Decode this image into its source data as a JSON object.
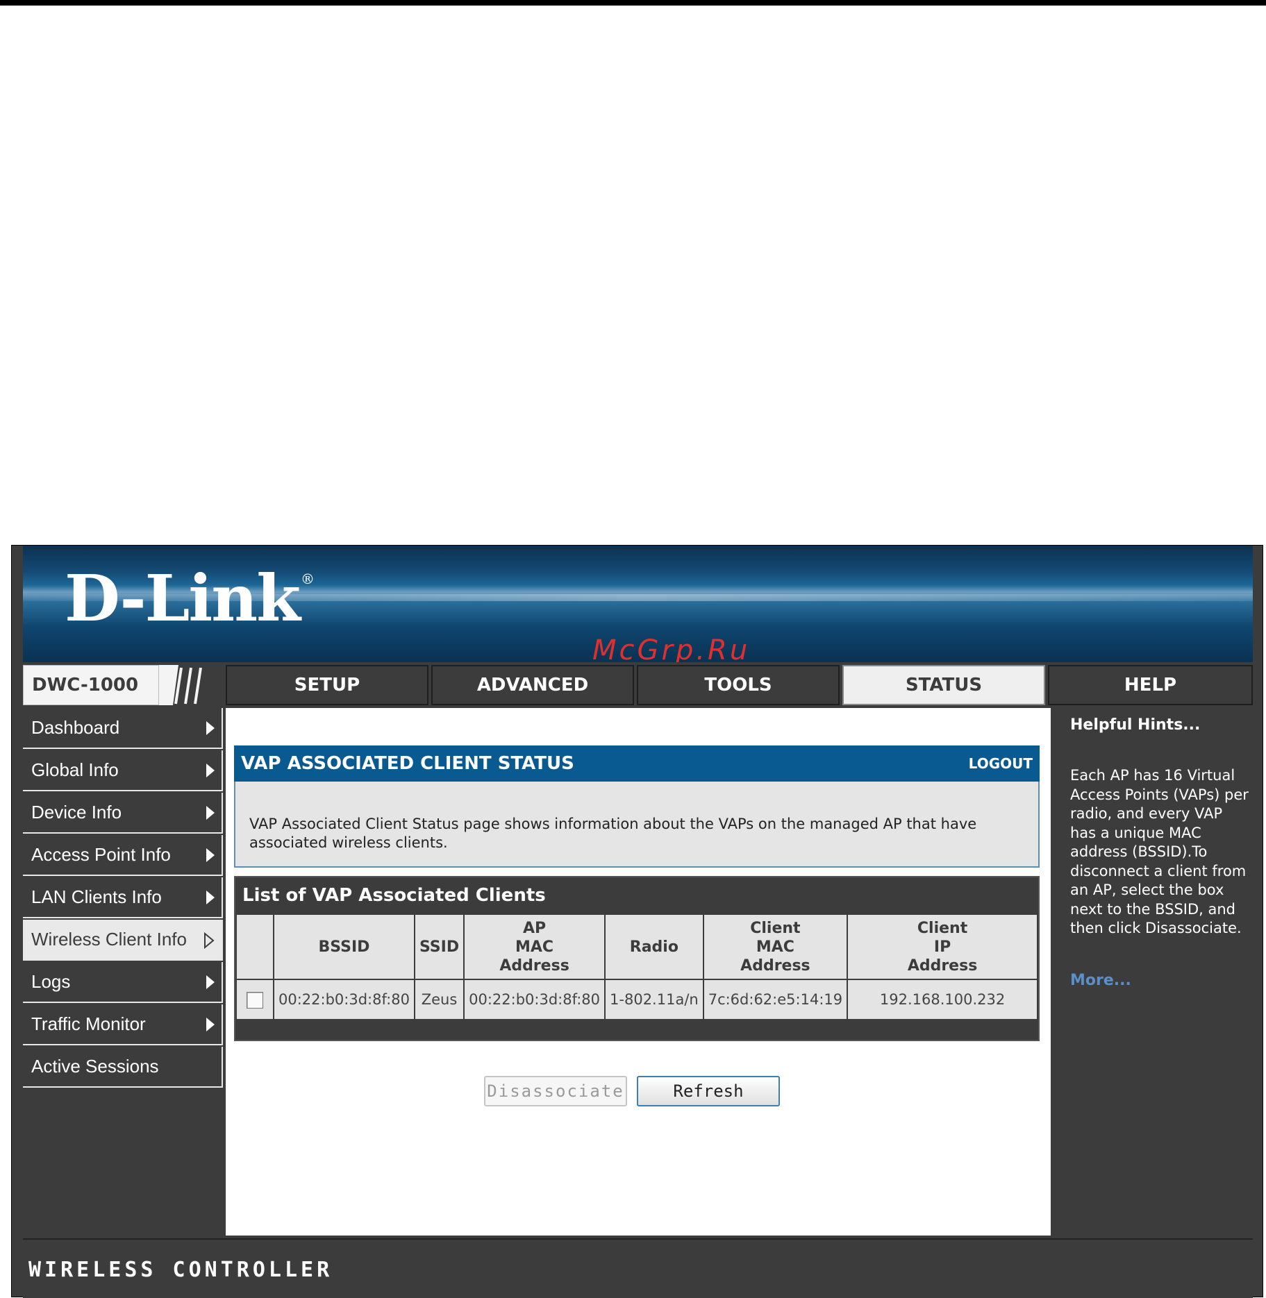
{
  "header": {
    "logo": "D-Link",
    "logo_mark": "®",
    "watermark": "McGrp.Ru",
    "model": "DWC-1000"
  },
  "nav": {
    "tabs": [
      {
        "label": "SETUP"
      },
      {
        "label": "ADVANCED"
      },
      {
        "label": "TOOLS"
      },
      {
        "label": "STATUS",
        "active": true
      },
      {
        "label": "HELP"
      }
    ]
  },
  "sidebar": {
    "items": [
      {
        "label": "Dashboard"
      },
      {
        "label": "Global Info"
      },
      {
        "label": "Device Info"
      },
      {
        "label": "Access Point Info"
      },
      {
        "label": "LAN Clients Info"
      },
      {
        "label": "Wireless Client Info",
        "active": true
      },
      {
        "label": "Logs"
      },
      {
        "label": "Traffic Monitor"
      },
      {
        "label": "Active Sessions"
      }
    ]
  },
  "main": {
    "panel_title": "VAP ASSOCIATED CLIENT STATUS",
    "logout_label": "LOGOUT",
    "description": "VAP Associated Client Status page shows information about the VAPs on the managed AP that have associated wireless clients.",
    "list_title": "List of VAP Associated Clients",
    "columns": [
      "",
      "BSSID",
      "SSID",
      "AP\nMAC\nAddress",
      "Radio",
      "Client\nMAC\nAddress",
      "Client\nIP\nAddress"
    ],
    "rows": [
      {
        "checked": false,
        "bssid": "00:22:b0:3d:8f:80",
        "ssid": "Zeus",
        "ap_mac": "00:22:b0:3d:8f:80",
        "radio": "1-802.11a/n",
        "client_mac": "7c:6d:62:e5:14:19",
        "client_ip": "192.168.100.232"
      }
    ],
    "disassociate_label": "Disassociate",
    "refresh_label": "Refresh"
  },
  "hints": {
    "title": "Helpful Hints...",
    "text": "Each AP has 16 Virtual Access Points (VAPs) per radio, and every VAP has a unique MAC address (BSSID).To disconnect a client from an AP, select the box next to the BSSID, and then click Disassociate.",
    "more_label": "More..."
  },
  "footer": {
    "label": "WIRELESS CONTROLLER"
  },
  "colors": {
    "banner": "#0f456e",
    "panel_header": "#0a5a92",
    "chrome": "#3c3c3c",
    "more_link": "#5a8fc8",
    "watermark": "#e0302d"
  }
}
